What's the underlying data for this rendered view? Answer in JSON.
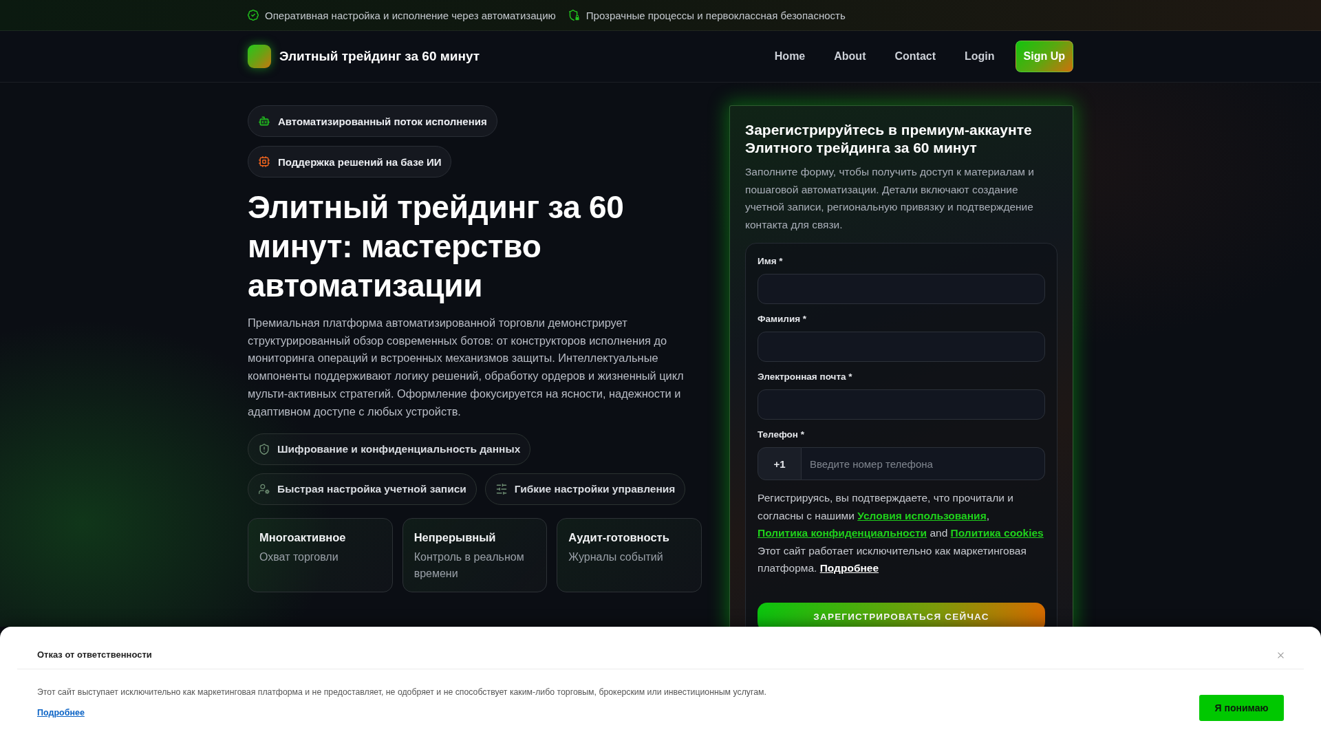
{
  "top_bar": {
    "items": [
      "Оперативная настройка и исполнение через автоматизацию",
      "Прозрачные процессы и первоклассная безопасность"
    ]
  },
  "header": {
    "brand": "Элитный трейдинг за 60 минут",
    "nav": [
      {
        "label": "Home"
      },
      {
        "label": "About"
      },
      {
        "label": "Contact"
      },
      {
        "label": "Login"
      }
    ],
    "signup_button": "Sign Up"
  },
  "hero": {
    "badges": [
      "Автоматизированный поток исполнения",
      "Поддержка решений на базе ИИ"
    ],
    "title": "Элитный трейдинг за 60 минут: мастерство автоматизации",
    "description": "Премиальная платформа автоматизированной торговли демонстрирует структурированный обзор современных ботов: от конструкторов исполнения до мониторинга операций и встроенных механизмов защиты. Интеллектуальные компоненты поддерживают логику решений, обработку ордеров и жизненный цикл мульти-активных стратегий. Оформление фокусируется на ясности, надежности и адаптивном доступе с любых устройств.",
    "features": [
      "Шифрование и конфиденциальность данных",
      "Быстрая настройка учетной записи",
      "Гибкие настройки управления"
    ],
    "stats": [
      {
        "title": "Многоактивное",
        "subtitle": "Охват торговли"
      },
      {
        "title": "Непрерывный",
        "subtitle": "Контроль в реальном времени"
      },
      {
        "title": "Аудит-готовность",
        "subtitle": "Журналы событий"
      }
    ]
  },
  "signup_form": {
    "title": "Зарегистрируйтесь в премиум-аккаунте Элитного трейдинга за 60 минут",
    "description": "Заполните форму, чтобы получить доступ к материалам и пошаговой автоматизации. Детали включают создание учетной записи, региональную привязку и подтверждение контакта для связи.",
    "fields": [
      {
        "kind": "text",
        "label": "Имя *"
      },
      {
        "kind": "text",
        "label": "Фамилия *"
      },
      {
        "kind": "text",
        "label": "Электронная почта *"
      },
      {
        "kind": "phone",
        "label": "Телефон *",
        "prefix": "+1",
        "placeholder": "Введите номер телефона"
      }
    ],
    "consent": [
      {
        "kind": "text",
        "text": "Регистрируясь, вы подтверждаете, что прочитали и согласны с нашими "
      },
      {
        "kind": "link",
        "text": "Условия использования"
      },
      {
        "kind": "text",
        "text": ", "
      },
      {
        "kind": "link",
        "text": "Политика конфиденциальности"
      },
      {
        "kind": "text",
        "text": " and "
      },
      {
        "kind": "link",
        "text": "Политика cookies"
      },
      {
        "kind": "text",
        "text": " Этот сайт работает исключительно как маркетинговая платформа. "
      },
      {
        "kind": "more_link",
        "text": "Подробнее"
      }
    ],
    "submit_button": "ЗАРЕГИСТРИРОВАТЬСЯ СЕЙЧАС"
  },
  "disclaimer": {
    "title": "Отказ от ответственности",
    "text": "Этот сайт выступает исключительно как маркетинговая платформа и не предоставляет, не одобряет и не способствует каким-либо торговым, брокерским или инвестиционным услугам.",
    "link": "Подробнее",
    "button": "Я понимаю"
  }
}
